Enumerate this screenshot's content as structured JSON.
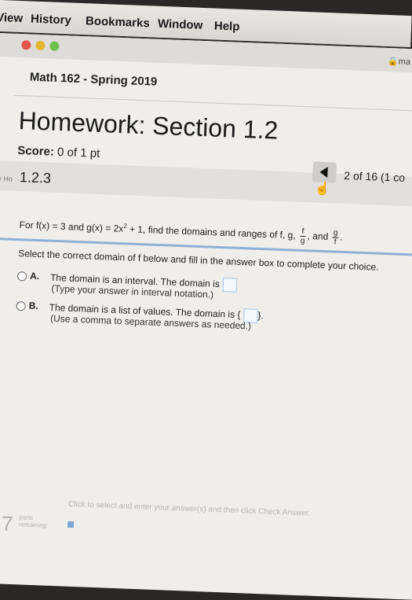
{
  "menubar": {
    "items": [
      "View",
      "History",
      "Bookmarks",
      "Window",
      "Help"
    ]
  },
  "browser": {
    "address_fragment": "ma",
    "colors": {
      "close": "#e2564b",
      "minimize": "#e7b435",
      "zoom": "#6fbf4a"
    }
  },
  "course": {
    "title": "Math 162 - Spring 2019"
  },
  "homework": {
    "title": "Homework: Section 1.2",
    "score_label": "Score:",
    "score_value": "0 of 1 pt",
    "question_number": "1.2.3",
    "counter": "2 of 16 (1 co",
    "crumb_fragment": "e Ho"
  },
  "question": {
    "prefix": "For f(x) = 3 and g(x) = 2x",
    "exp": "2",
    "middle": " + 1, find the domains and ranges of f, g,",
    "frac1_num": "f",
    "frac1_den": "g",
    "and": ", and",
    "frac2_num": "g",
    "frac2_den": "f",
    "instruction": "Select the correct domain of f below and fill in the answer box to complete your choice."
  },
  "options": [
    {
      "letter": "A.",
      "text": "The domain is an interval. The domain is",
      "hint": "(Type your answer in interval notation.)"
    },
    {
      "letter": "B.",
      "text": "The domain is a list of values. The domain is {",
      "text_after": "}.",
      "hint": "(Use a comma to separate answers as needed.)"
    }
  ],
  "footer": {
    "hint": "Click to select and enter your answer(s) and then click Check Answer.",
    "parts_count": "7",
    "parts_label_1": "parts",
    "parts_label_2": "remaining"
  }
}
